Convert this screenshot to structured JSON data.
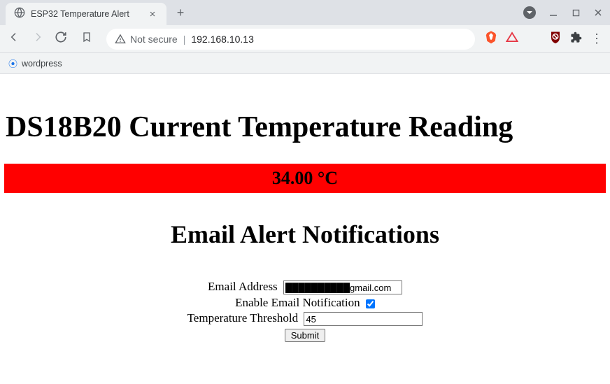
{
  "browser": {
    "tab_title": "ESP32 Temperature Alert",
    "address_security": "Not secure",
    "address_url": "192.168.10.13",
    "bookmark_item": "wordpress"
  },
  "page": {
    "heading_main": "DS18B20 Current Temperature Reading",
    "temperature_reading": "34.00 °C",
    "heading_alerts": "Email Alert Notifications",
    "form": {
      "email_label": "Email Address",
      "email_value_suffix": "gmail.com",
      "enable_label": "Enable Email Notification",
      "enable_checked": true,
      "threshold_label": "Temperature Threshold",
      "threshold_value": "45",
      "submit_label": "Submit"
    }
  }
}
